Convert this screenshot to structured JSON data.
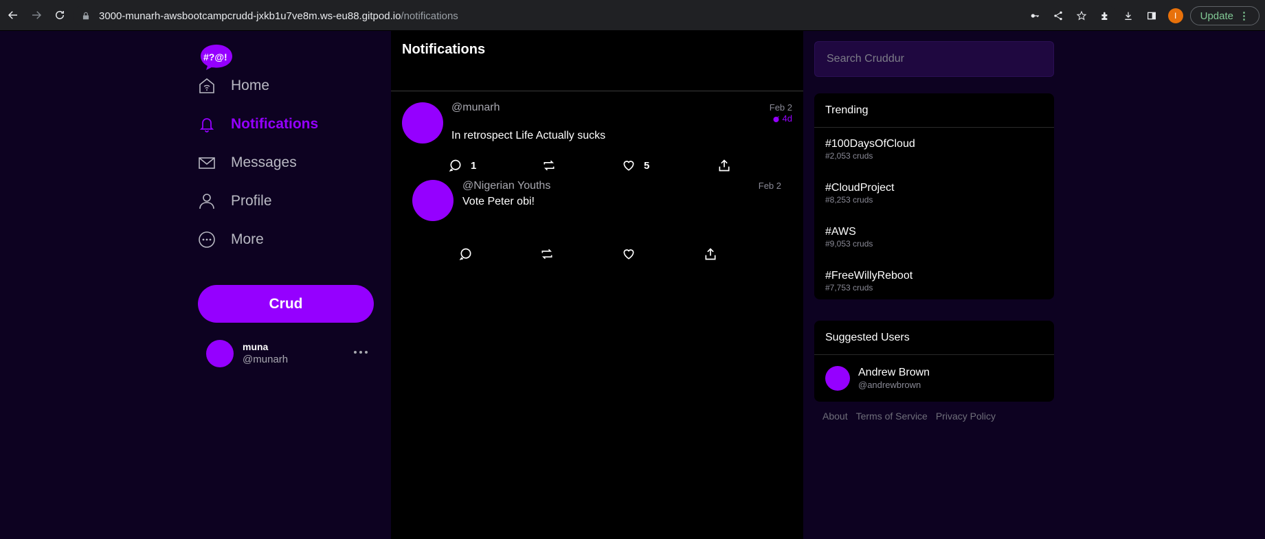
{
  "browser": {
    "url_host": "3000-munarh-awsbootcampcrudd-jxkb1u7ve8m.ws-eu88.gitpod.io",
    "url_path": "/notifications",
    "profile_initial": "I",
    "update_label": "Update"
  },
  "sidebar": {
    "logo_text": "#?@!",
    "items": [
      {
        "label": "Home",
        "icon": "home-icon"
      },
      {
        "label": "Notifications",
        "icon": "bell-icon"
      },
      {
        "label": "Messages",
        "icon": "mail-icon"
      },
      {
        "label": "Profile",
        "icon": "user-icon"
      },
      {
        "label": "More",
        "icon": "more-circle-icon"
      }
    ],
    "crud_label": "Crud",
    "profile": {
      "name": "muna",
      "handle": "@munarh"
    }
  },
  "feed": {
    "title": "Notifications",
    "posts": [
      {
        "handle": "@munarh",
        "date": "Feb 2",
        "expires": "4d",
        "message": "In retrospect Life Actually sucks",
        "reply_count": "1",
        "like_count": "5"
      },
      {
        "handle": "@Nigerian Youths",
        "date": "Feb 2",
        "message": "Vote Peter obi!"
      }
    ]
  },
  "right": {
    "search_placeholder": "Search Cruddur",
    "trending_title": "Trending",
    "trends": [
      {
        "name": "#100DaysOfCloud",
        "count": "#2,053 cruds"
      },
      {
        "name": "#CloudProject",
        "count": "#8,253 cruds"
      },
      {
        "name": "#AWS",
        "count": "#9,053 cruds"
      },
      {
        "name": "#FreeWillyReboot",
        "count": "#7,753 cruds"
      }
    ],
    "suggested_title": "Suggested Users",
    "suggested": [
      {
        "name": "Andrew Brown",
        "handle": "@andrewbrown"
      }
    ],
    "footer": [
      "About",
      "Terms of Service",
      "Privacy Policy"
    ]
  },
  "colors": {
    "accent": "#9500ff",
    "background": "#0d0221",
    "panel": "#000000"
  }
}
